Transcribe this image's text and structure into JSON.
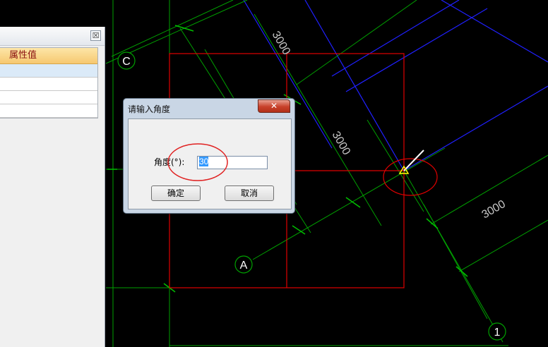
{
  "properties_panel": {
    "close_label": "☒",
    "column_header": "属性值"
  },
  "canvas": {
    "dimension_labels": [
      "3000",
      "3000",
      "3000"
    ],
    "axis_labels": [
      "C",
      "A",
      "1"
    ],
    "colors": {
      "background": "#000000",
      "grid": "#00a000",
      "boundary": "#e00000",
      "blue_axis": "#0000ff",
      "marker": "#ffff00"
    }
  },
  "dialog": {
    "title": "请输入角度",
    "close_label": "✕",
    "angle_label": "角度(°):",
    "angle_value": "30",
    "ok_label": "确定",
    "cancel_label": "取消"
  }
}
